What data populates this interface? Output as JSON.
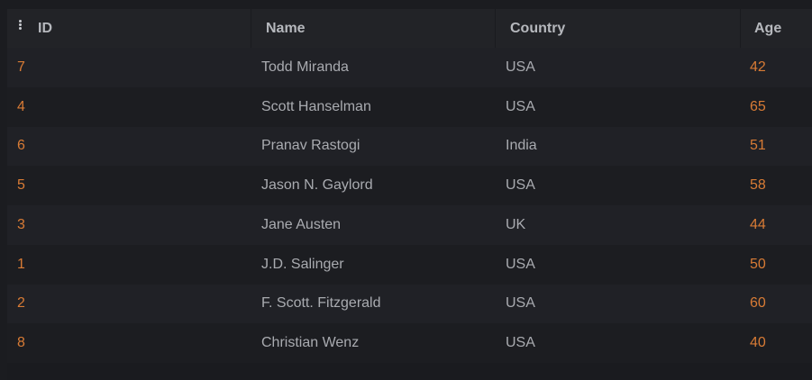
{
  "table": {
    "columns": {
      "id": "ID",
      "name": "Name",
      "country": "Country",
      "age": "Age"
    },
    "rows": [
      {
        "id": "7",
        "name": "Todd Miranda",
        "country": "USA",
        "age": "42"
      },
      {
        "id": "4",
        "name": "Scott Hanselman",
        "country": "USA",
        "age": "65"
      },
      {
        "id": "6",
        "name": "Pranav Rastogi",
        "country": "India",
        "age": "51"
      },
      {
        "id": "5",
        "name": "Jason N. Gaylord",
        "country": "USA",
        "age": "58"
      },
      {
        "id": "3",
        "name": "Jane Austen",
        "country": "UK",
        "age": "44"
      },
      {
        "id": "1",
        "name": "J.D. Salinger",
        "country": "USA",
        "age": "50"
      },
      {
        "id": "2",
        "name": "F. Scott. Fitzgerald",
        "country": "USA",
        "age": "60"
      },
      {
        "id": "8",
        "name": "Christian Wenz",
        "country": "USA",
        "age": "40"
      }
    ]
  },
  "icons": {
    "column_menu": "vertical-dots-icon"
  },
  "colors": {
    "background": "#1a1b1f",
    "header_bg": "#222327",
    "accent_number": "#d87b35",
    "text": "#a9abb0",
    "header_text": "#b6b8bd"
  }
}
